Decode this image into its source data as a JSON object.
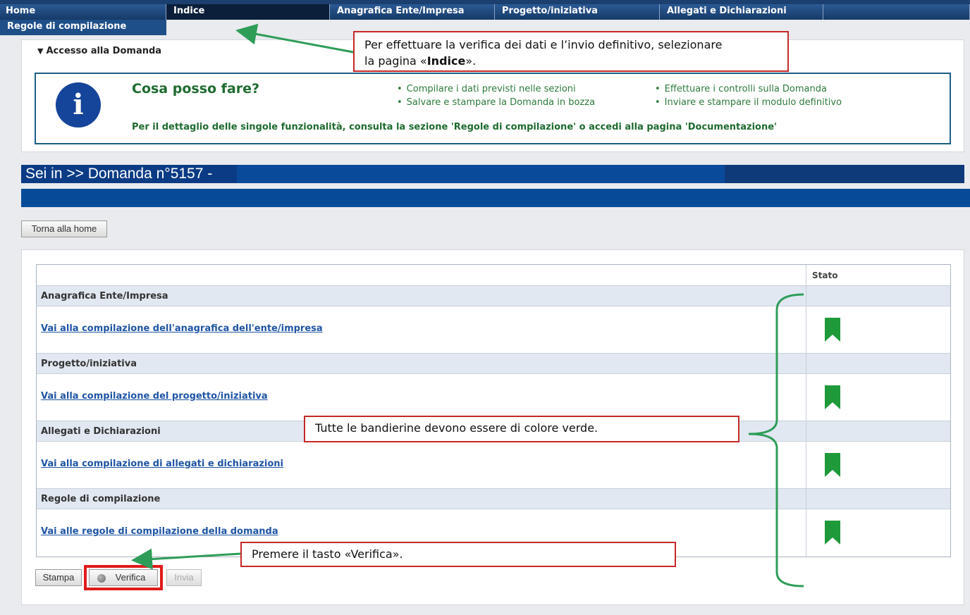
{
  "nav": {
    "tabs": [
      {
        "label": "Home"
      },
      {
        "label": "Indice"
      },
      {
        "label": "Anagrafica Ente/Impresa"
      },
      {
        "label": "Progetto/iniziativa"
      },
      {
        "label": "Allegati e Dichiarazioni"
      }
    ],
    "subtab": "Regole di compilazione"
  },
  "accesso": {
    "title": "Accesso alla Domanda",
    "info_title": "Cosa posso fare?",
    "bullets_left": [
      "Compilare i dati previsti nelle sezioni",
      "Salvare e stampare la Domanda in bozza"
    ],
    "bullets_right": [
      "Effettuare i controlli sulla Domanda",
      "Inviare e stampare il modulo definitivo"
    ],
    "detail": "Per il dettaglio delle singole funzionalità, consulta la sezione 'Regole di compilazione' o accedi alla pagina 'Documentazione'"
  },
  "breadcrumb": "Sei in >> Domanda n°5157 -",
  "torna_button": "Torna alla home",
  "table": {
    "stato_header": "Stato",
    "sections": [
      {
        "title": "Anagrafica Ente/Impresa",
        "link": "Vai alla compilazione dell'anagrafica dell'ente/impresa",
        "status": "complete"
      },
      {
        "title": "Progetto/iniziativa",
        "link": "Vai alla compilazione del progetto/iniziativa",
        "status": "complete"
      },
      {
        "title": "Allegati e Dichiarazioni",
        "link": "Vai alla compilazione di allegati e dichiarazioni",
        "status": "complete"
      },
      {
        "title": "Regole di compilazione",
        "link": "Vai alle regole di compilazione della domanda",
        "status": "complete"
      }
    ]
  },
  "actions": {
    "stampa": "Stampa",
    "verifica": "Verifica",
    "invia": "Invia"
  },
  "annotations": {
    "top_line1": "Per effettuare la verifica dei dati e l’invio definitivo, selezionare",
    "top_line2_pre": "la pagina «",
    "top_line2_bold": "Indice",
    "top_line2_post": "».",
    "middle": "Tutte le bandierine devono essere di colore verde.",
    "bottom": "Premere il tasto «Verifica»."
  },
  "colors": {
    "flag_green": "#1f9a3a",
    "nav_blue": "#1b3f6e",
    "callout_red": "#c62828",
    "arrow_green": "#2e9d58"
  }
}
